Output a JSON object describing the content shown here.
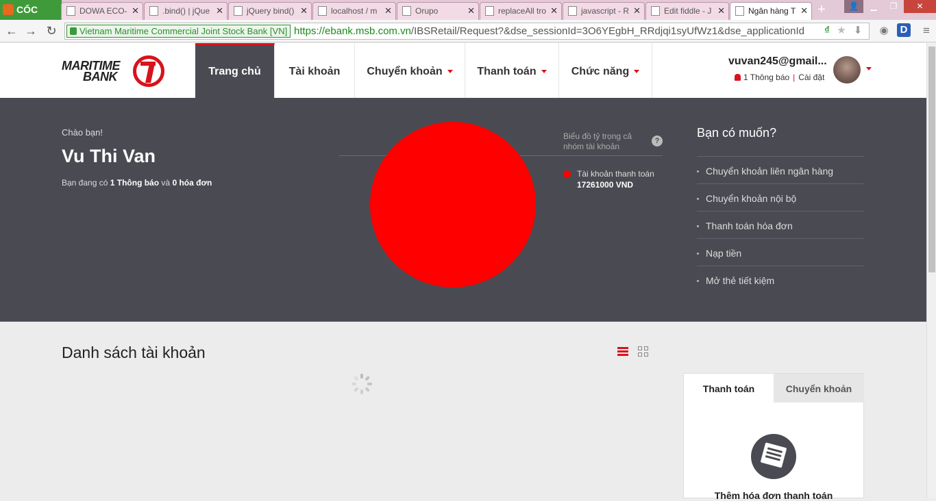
{
  "browser": {
    "brand": "CỐC CỐC",
    "tabs": [
      {
        "title": "DOWA ECO-"
      },
      {
        "title": ".bind() | jQue"
      },
      {
        "title": "jQuery bind()"
      },
      {
        "title": "localhost / m"
      },
      {
        "title": "Orupo"
      },
      {
        "title": "replaceAll tro"
      },
      {
        "title": "javascript - R"
      },
      {
        "title": "Edit fiddle - J"
      },
      {
        "title": "Ngân hàng T"
      }
    ],
    "ev_label": "Vietnam Maritime Commercial Joint Stock Bank [VN]",
    "url_host": "https://ebank.msb.com.vn",
    "url_path": "/IBSRetail/Request?&dse_sessionId=3O6YEgbH_RRdjqi1syUfWz1&dse_applicationId"
  },
  "header": {
    "logo_line1": "MARITIME",
    "logo_line2": "BANK",
    "nav": [
      {
        "label": "Trang chủ"
      },
      {
        "label": "Tài khoản"
      },
      {
        "label": "Chuyển khoản"
      },
      {
        "label": "Thanh toán"
      },
      {
        "label": "Chức năng"
      }
    ],
    "user_email": "vuvan245@gmail...",
    "notifications": "1 Thông báo",
    "settings": "Cài đặt"
  },
  "hero": {
    "greeting": "Chào bạn!",
    "name": "Vu Thi Van",
    "summary_prefix": "Bạn đang có",
    "summary_notif": "1 Thông báo",
    "summary_mid": "và",
    "summary_bills": "0 hóa đơn",
    "chart_title": "Biểu đồ tỷ trọng cả nhóm tài khoản",
    "help": "?",
    "want_title": "Bạn có muốn?",
    "want_items": [
      "Chuyển khoản liên ngân hàng",
      "Chuyển khoản nội bộ",
      "Thanh toán hóa đơn",
      "Nạp tiền",
      "Mở thẻ tiết kiệm"
    ]
  },
  "chart_data": {
    "type": "pie",
    "slices": [
      {
        "label": "Tài khoản thanh toán",
        "value": 17261000,
        "display": "17261000 VND",
        "color": "#ff0000"
      }
    ]
  },
  "accounts": {
    "title": "Danh sách tài khoản"
  },
  "panel": {
    "tab_active": "Thanh toán",
    "tab_inactive": "Chuyển khoản",
    "add_bill": "Thêm hóa đơn thanh toán"
  },
  "colors": {
    "brand_red": "#d8131b",
    "hero_bg": "#4a4a52"
  }
}
